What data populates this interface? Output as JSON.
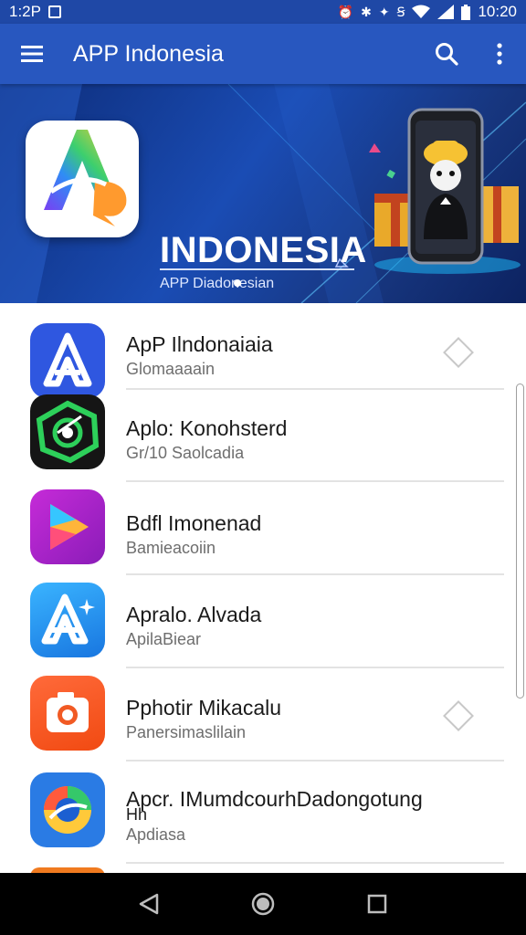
{
  "status_bar": {
    "time": "1:2P",
    "clock_right": "10:20",
    "icons_left": [
      "image-icon"
    ],
    "icons_right": [
      "alarm-icon",
      "bluetooth-icon",
      "vibrate-icon",
      "nfc-icon",
      "wifi-icon",
      "signal-icon",
      "battery-icon"
    ]
  },
  "app_bar": {
    "title": "APP Indonesia",
    "menu_icon": "hamburger-menu-icon",
    "search_icon": "search-icon",
    "more_icon": "more-vert-icon"
  },
  "banner": {
    "title": "INDONESIA",
    "subtitle": "APP Diadonesian",
    "page_indicator_count": 1
  },
  "apps": [
    {
      "name": "ApP Ilndonaiaia",
      "subtitle": "Glomaaaain",
      "icon": "letter-a-blue-icon",
      "action_icon": "diamond-icon"
    },
    {
      "name": "Aplo: Konohsterd",
      "subtitle": "Gr/10 Saolcadia",
      "icon": "green-eye-icon",
      "action_icon": ""
    },
    {
      "name": "Bdfl Imonenad",
      "subtitle": "Bamieacoiin",
      "icon": "play-triangle-icon",
      "action_icon": ""
    },
    {
      "name": "Apralo. Alvada",
      "subtitle": "ApilaBiear",
      "icon": "app-store-a-icon",
      "action_icon": ""
    },
    {
      "name": "Pphotir Mikacalu",
      "subtitle": "Panersimaslilain",
      "icon": "camera-icon",
      "action_icon": "diamond-icon"
    },
    {
      "name": "Apcr. IMumdcourhDadongotung",
      "name_line2": "Hh",
      "subtitle": "Apdiasa",
      "icon": "colorful-swirl-icon",
      "action_icon": ""
    }
  ],
  "colors": {
    "status_bar": "#1f48a6",
    "app_bar": "#2857bf",
    "banner_dark": "#0d2c78",
    "accent_blue": "#2563d9",
    "nav_bar": "#000000"
  },
  "nav_bar": {
    "back_icon": "back-triangle-icon",
    "home_icon": "home-circle-icon",
    "recents_icon": "recents-square-icon"
  }
}
